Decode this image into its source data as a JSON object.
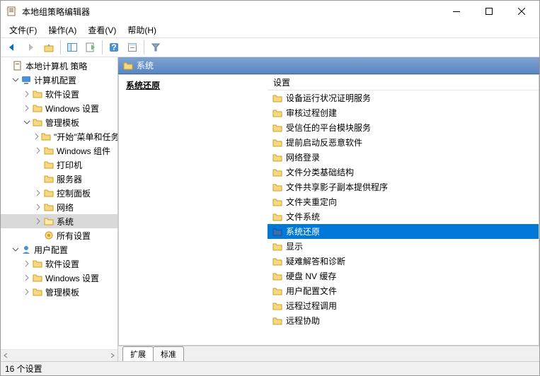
{
  "window": {
    "title": "本地组策略编辑器"
  },
  "menu": {
    "file": "文件(F)",
    "action": "操作(A)",
    "view": "查看(V)",
    "help": "帮助(H)"
  },
  "tree": {
    "root": "本地计算机 策略",
    "computer_config": "计算机配置",
    "cc_software": "软件设置",
    "cc_windows": "Windows 设置",
    "cc_admin": "管理模板",
    "at_startmenu": "\"开始\"菜单和任务栏",
    "at_wincomp": "Windows 组件",
    "at_printers": "打印机",
    "at_server": "服务器",
    "at_cp": "控制面板",
    "at_network": "网络",
    "at_system": "系统",
    "at_allsettings": "所有设置",
    "user_config": "用户配置",
    "uc_software": "软件设置",
    "uc_windows": "Windows 设置",
    "uc_admin": "管理模板"
  },
  "content": {
    "header": "系统",
    "heading": "系统还原",
    "column_header": "设置",
    "items": [
      "设备运行状况证明服务",
      "审核过程创建",
      "受信任的平台模块服务",
      "提前启动反恶意软件",
      "网络登录",
      "文件分类基础结构",
      "文件共享影子副本提供程序",
      "文件夹重定向",
      "文件系统",
      "系统还原",
      "显示",
      "疑难解答和诊断",
      "硬盘 NV 缓存",
      "用户配置文件",
      "远程过程调用",
      "远程协助"
    ],
    "selected_index": 9
  },
  "tabs": {
    "extended": "扩展",
    "standard": "标准"
  },
  "status": {
    "text": "16 个设置"
  }
}
